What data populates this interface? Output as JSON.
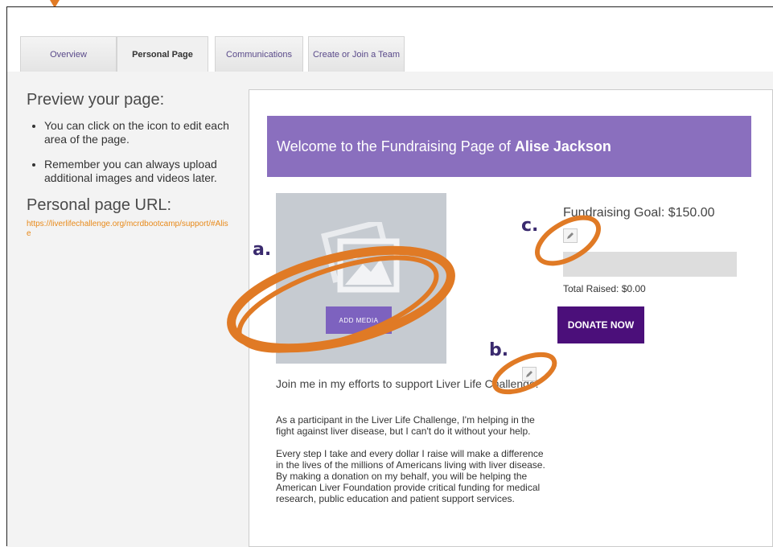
{
  "tabs": [
    {
      "label": "Overview"
    },
    {
      "label": "Personal Page"
    },
    {
      "label": "Communications"
    },
    {
      "label": "Create or Join a Team"
    }
  ],
  "left": {
    "preview_heading": "Preview your page:",
    "tips": [
      "You can click on the icon to edit each area of the page.",
      "Remember you can always upload additional images and videos later."
    ],
    "url_heading": "Personal page URL:",
    "url": "https://liverlifechallenge.org/mcrdbootcamp/support/#Alise"
  },
  "preview": {
    "banner_prefix": "Welcome to the Fundraising Page of",
    "banner_name": "Alise Jackson",
    "add_media_label": "ADD MEDIA",
    "goal_text": "Fundraising Goal: $150.00",
    "raised_text": "Total Raised: $0.00",
    "donate_label": "DONATE NOW",
    "story_title": "Join me in my efforts to support Liver Life Challenge!",
    "story_paragraphs": [
      "As a participant in the Liver Life Challenge, I'm helping in the fight against liver disease, but I can't do it without your help.",
      "Every step I take and every dollar I raise will make a difference in the lives of the millions of Americans living with liver disease. By making a donation on my behalf, you will be helping the American Liver Foundation provide critical funding for medical research, public education and patient support services."
    ]
  },
  "annotations": {
    "a": "a.",
    "b": "b.",
    "c": "c."
  },
  "colors": {
    "banner": "#8a6fbe",
    "donate": "#4b0f7a",
    "annotation_ring": "#e07a25",
    "url_link": "#e88a1a"
  }
}
